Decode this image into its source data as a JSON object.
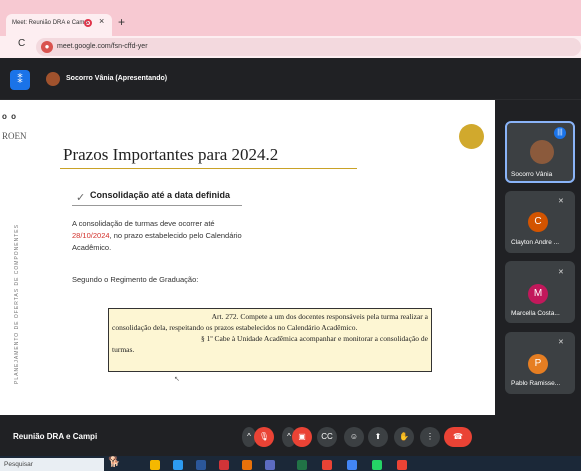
{
  "browser": {
    "tab_title": "Meet: Reunião DRA e Camp",
    "tab_close": "×",
    "new_tab": "+",
    "reload": "C",
    "url": "meet.google.com/fsn-cffd-yer"
  },
  "meet_header": {
    "presenter": "Socorro Vânia (Apresentando)"
  },
  "slide": {
    "dots": "o o",
    "logo_text": "ROEN",
    "vertical_label": "PLANEJAMENTO DE OFERTAS DE COMPONENTES",
    "title": "Prazos Importantes para 2024.2",
    "check_mark": "✓",
    "check_text": "Consolidação até a data definida",
    "para_part1": "A consolidação de turmas deve ocorrer até",
    "para_date": "28/10/2024",
    "para_part2": ", no prazo estabelecido pelo Calendário Acadêmico.",
    "para2": "Segundo o Regimento de Graduação:",
    "quote_line1": "Art. 272. Compete a um dos docentes responsáveis pela turma realizar a",
    "quote_line2": "consolidação dela, respeitando os prazos estabelecidos no Calendário Acadêmico.",
    "quote_line3": "§ 1º Cabe à Unidade Acadêmica acompanhar e monitorar a consolidação de",
    "quote_line4": "turmas."
  },
  "participants": [
    {
      "name": "Socorro Vânia",
      "initial": "",
      "speaking": true
    },
    {
      "name": "Clayton Andre ...",
      "initial": "C",
      "muted": true
    },
    {
      "name": "Marcella Costa...",
      "initial": "M",
      "muted": true
    },
    {
      "name": "Pablo Ramisse...",
      "initial": "P",
      "muted": true
    }
  ],
  "bottom_bar": {
    "meeting_name": "Reunião DRA e Campi"
  },
  "taskbar": {
    "search_placeholder": "Pesquisar"
  },
  "colors": {
    "meet_bg": "#202124",
    "end_call": "#ea4335",
    "accent_blue": "#1a73e8",
    "slide_date_red": "#d2312b",
    "gold": "#d1a92d"
  }
}
